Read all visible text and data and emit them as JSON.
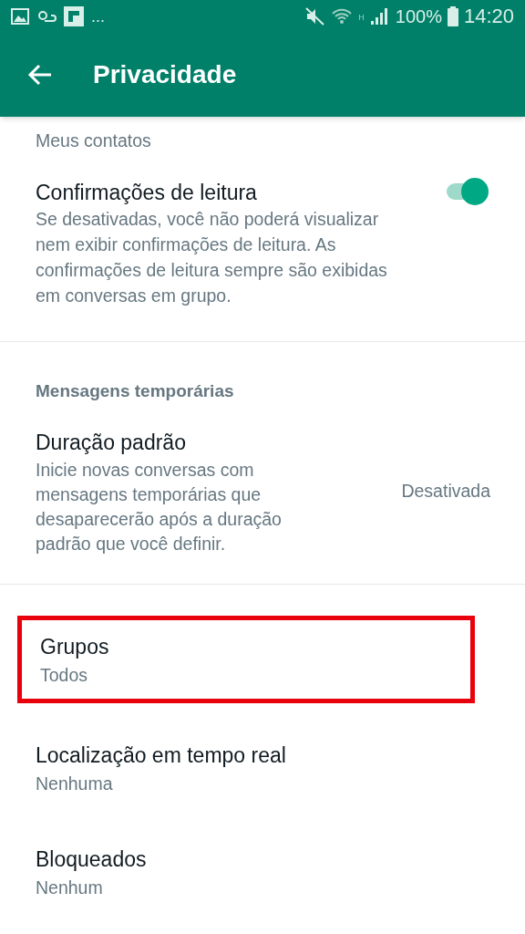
{
  "status_bar": {
    "notification_overflow": "...",
    "network": "H",
    "battery": "100%",
    "time": "14:20"
  },
  "app_bar": {
    "title": "Privacidade"
  },
  "items": [
    {
      "kind": "setting",
      "subtitle": "Meus contatos",
      "highlighted": false
    },
    {
      "kind": "toggle",
      "title": "Confirmações de leitura",
      "subtitle": "Se desativadas, você não poderá visualizar nem exibir confirmações de leitura. As confirmações de leitura sempre são exibidas em conversas em grupo.",
      "on": true
    },
    {
      "kind": "divider"
    },
    {
      "kind": "header",
      "title": "Mensagens temporárias"
    },
    {
      "kind": "value",
      "title": "Duração padrão",
      "subtitle": "Inicie novas conversas com mensagens temporárias que desaparecerão após a duração padrão que você definir.",
      "value": "Desativada"
    },
    {
      "kind": "divider"
    },
    {
      "kind": "setting",
      "title": "Grupos",
      "subtitle": "Todos",
      "highlighted": true
    },
    {
      "kind": "setting",
      "title": "Localização em tempo real",
      "subtitle": "Nenhuma",
      "highlighted": false
    },
    {
      "kind": "setting",
      "title": "Bloqueados",
      "subtitle": "Nenhum",
      "highlighted": false
    }
  ]
}
